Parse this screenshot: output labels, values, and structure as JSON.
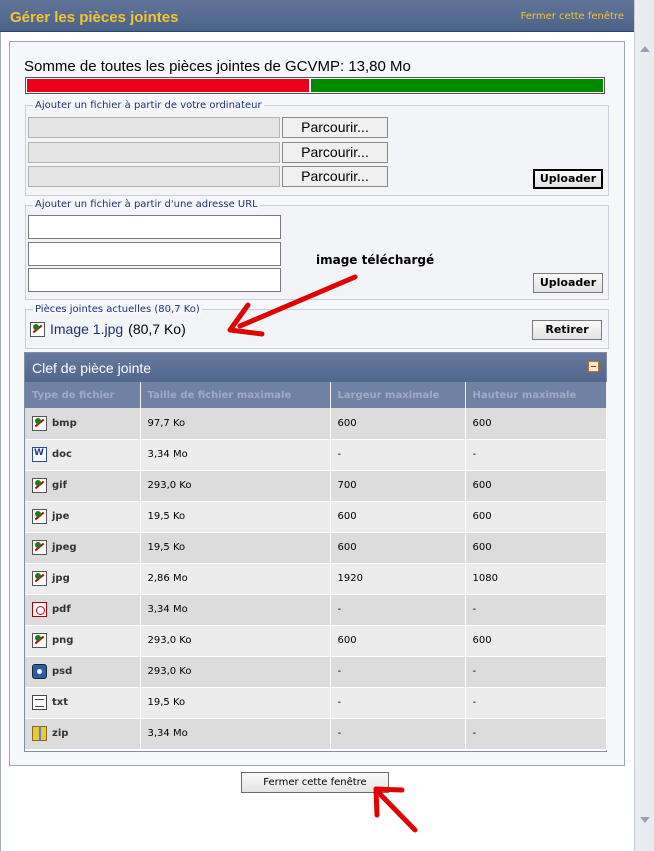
{
  "window": {
    "title": "Gérer les pièces jointes",
    "close_link": "Fermer cette fenêtre"
  },
  "quota": {
    "label": "Somme de toutes les pièces jointes de GCVMP: 13,80 Mo",
    "used_fraction": 0.49,
    "used_color": "#e8001c",
    "free_color": "#008a00"
  },
  "upload_computer": {
    "legend": "Ajouter un fichier à partir de votre ordinateur",
    "browse_label": "Parcourir...",
    "upload_label": "Uploader"
  },
  "upload_url": {
    "legend": "Ajouter un fichier à partir d'une adresse URL",
    "upload_label": "Uploader"
  },
  "annotation": "image téléchargé",
  "current": {
    "legend": "Pièces jointes actuelles (80,7 Ko)",
    "file_name": "Image 1.jpg",
    "file_size": "(80,7 Ko)",
    "remove_label": "Retirer"
  },
  "key": {
    "title": "Clef de pièce jointe",
    "headers": [
      "Type de fichier",
      "Taille de fichier maximale",
      "Largeur maximale",
      "Hauteur maximale"
    ],
    "rows": [
      {
        "icon": "image-icon",
        "type": "bmp",
        "size": "97,7 Ko",
        "width": "600",
        "height": "600"
      },
      {
        "icon": "word-document-icon",
        "type": "doc",
        "size": "3,34 Mo",
        "width": "-",
        "height": "-"
      },
      {
        "icon": "image-icon",
        "type": "gif",
        "size": "293,0 Ko",
        "width": "700",
        "height": "600"
      },
      {
        "icon": "image-icon",
        "type": "jpe",
        "size": "19,5 Ko",
        "width": "600",
        "height": "600"
      },
      {
        "icon": "image-icon",
        "type": "jpeg",
        "size": "19,5 Ko",
        "width": "600",
        "height": "600"
      },
      {
        "icon": "image-icon",
        "type": "jpg",
        "size": "2,86 Mo",
        "width": "1920",
        "height": "1080"
      },
      {
        "icon": "pdf-icon",
        "type": "pdf",
        "size": "3,34 Mo",
        "width": "-",
        "height": "-"
      },
      {
        "icon": "image-icon",
        "type": "png",
        "size": "293,0 Ko",
        "width": "600",
        "height": "600"
      },
      {
        "icon": "psd-icon",
        "type": "psd",
        "size": "293,0 Ko",
        "width": "-",
        "height": "-"
      },
      {
        "icon": "text-file-icon",
        "type": "txt",
        "size": "19,5 Ko",
        "width": "-",
        "height": "-"
      },
      {
        "icon": "zip-archive-icon",
        "type": "zip",
        "size": "3,34 Mo",
        "width": "-",
        "height": "-"
      }
    ]
  },
  "close_button": "Fermer cette fenêtre"
}
